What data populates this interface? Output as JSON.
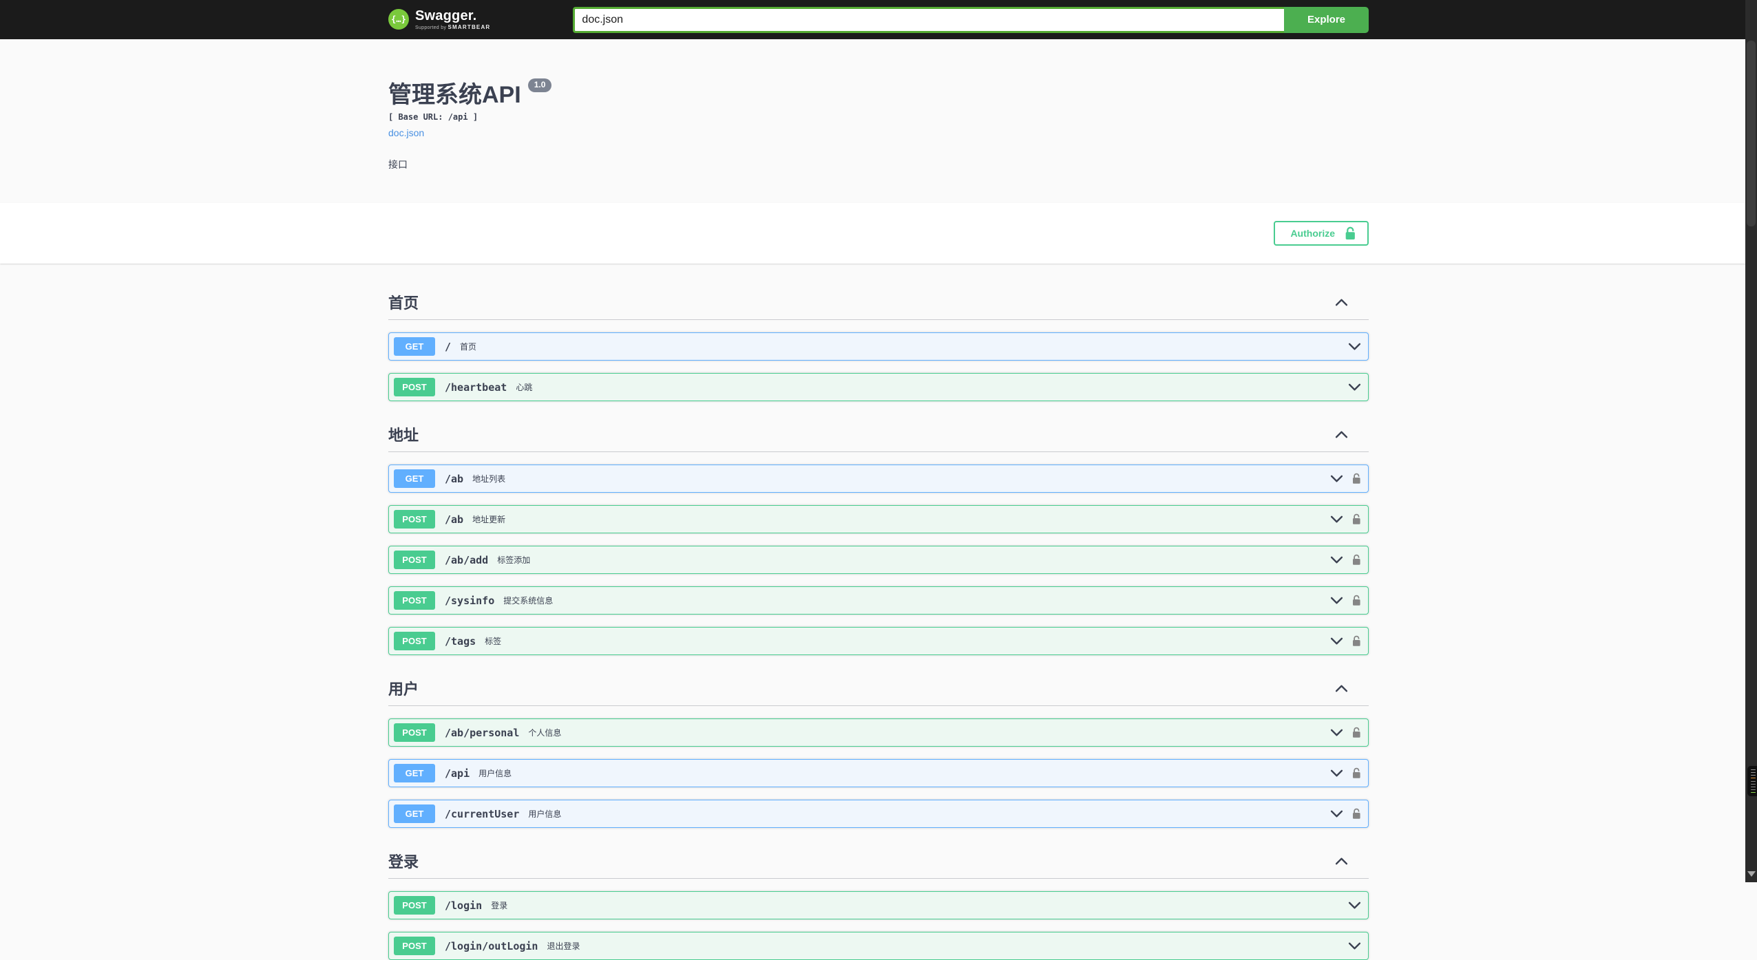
{
  "topbar": {
    "logo_glyph": "{…}",
    "logo_text": "Swagger.",
    "logo_sub_prefix": "Supported by",
    "logo_sub_brand": "SMARTBEAR",
    "search_value": "doc.json",
    "explore_label": "Explore"
  },
  "info": {
    "title": "管理系统API",
    "version_badge": "1.0",
    "base_url_line": "[ Base URL: /api ]",
    "spec_link": "doc.json",
    "description": "接口"
  },
  "auth": {
    "authorize_label": "Authorize"
  },
  "colors": {
    "topbar_bg": "#1b1b1b",
    "explore_green": "#4caf50",
    "logo_green": "#7ac93c",
    "get_blue": "#61affe",
    "post_green": "#49cc90",
    "authorize_green": "#49cc90",
    "link_blue": "#4990e2",
    "text": "#3b4151",
    "version_badge_bg": "#7d8492",
    "lock_gray": "#858585"
  },
  "icons": {
    "logo": "swagger-braces-icon",
    "section_expanded": "chevron-up-icon",
    "operation_collapsed": "chevron-down-icon",
    "auth": "unlocked-padlock-icon"
  },
  "sections": [
    {
      "title": "首页",
      "expanded": true,
      "operations": [
        {
          "method": "GET",
          "path": "/",
          "summary": "首页",
          "locked": false
        },
        {
          "method": "POST",
          "path": "/heartbeat",
          "summary": "心跳",
          "locked": false
        }
      ]
    },
    {
      "title": "地址",
      "expanded": true,
      "operations": [
        {
          "method": "GET",
          "path": "/ab",
          "summary": "地址列表",
          "locked": true
        },
        {
          "method": "POST",
          "path": "/ab",
          "summary": "地址更新",
          "locked": true
        },
        {
          "method": "POST",
          "path": "/ab/add",
          "summary": "标签添加",
          "locked": true
        },
        {
          "method": "POST",
          "path": "/sysinfo",
          "summary": "提交系统信息",
          "locked": true
        },
        {
          "method": "POST",
          "path": "/tags",
          "summary": "标签",
          "locked": true
        }
      ]
    },
    {
      "title": "用户",
      "expanded": true,
      "operations": [
        {
          "method": "POST",
          "path": "/ab/personal",
          "summary": "个人信息",
          "locked": true
        },
        {
          "method": "GET",
          "path": "/api",
          "summary": "用户信息",
          "locked": true
        },
        {
          "method": "GET",
          "path": "/currentUser",
          "summary": "用户信息",
          "locked": true
        }
      ]
    },
    {
      "title": "登录",
      "expanded": true,
      "operations": [
        {
          "method": "POST",
          "path": "/login",
          "summary": "登录",
          "locked": false
        },
        {
          "method": "POST",
          "path": "/login/outLogin",
          "summary": "退出登录",
          "locked": false
        }
      ]
    }
  ],
  "overlay_widget": {
    "bar_colors": [
      "#9a9a9a",
      "#9a9a9a",
      "#9a9a9a",
      "#e2943a",
      "#8a8a8a",
      "#8a8a8a",
      "#8a8a8a",
      "#8a8a8a",
      "#8ddb4e"
    ]
  }
}
